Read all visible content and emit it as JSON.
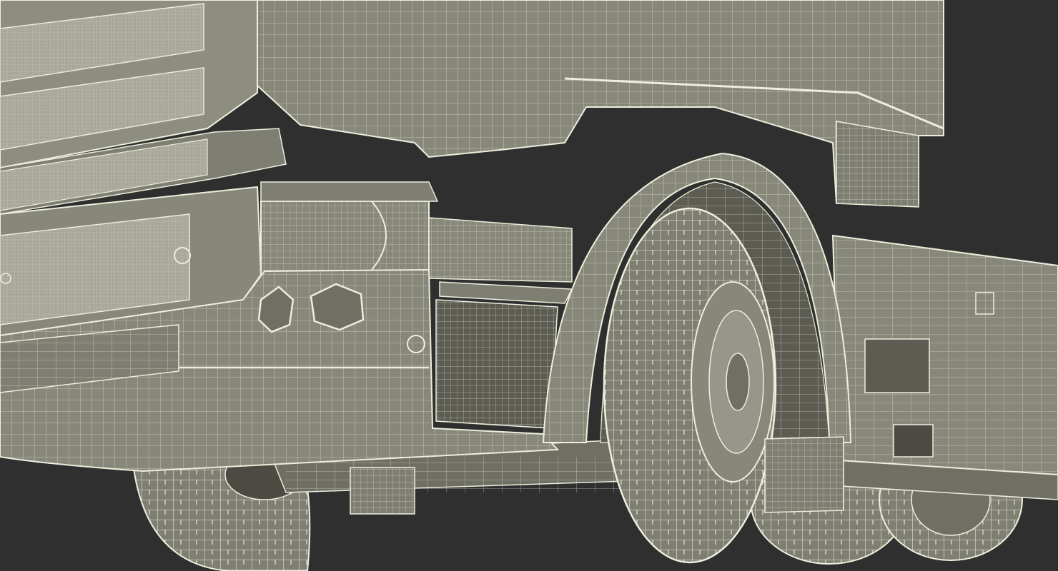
{
  "image": {
    "subject": "truck-wireframe-render",
    "colors": {
      "background": "#2f2f2f",
      "body_fill": "#87877a",
      "body_fill_dark": "#6f6f64",
      "body_fill_light": "#96968a",
      "wire": "#eeeedd",
      "shadow": "#4b4b44",
      "tire": "#7e7e72",
      "mesh": "#a8a898"
    }
  }
}
